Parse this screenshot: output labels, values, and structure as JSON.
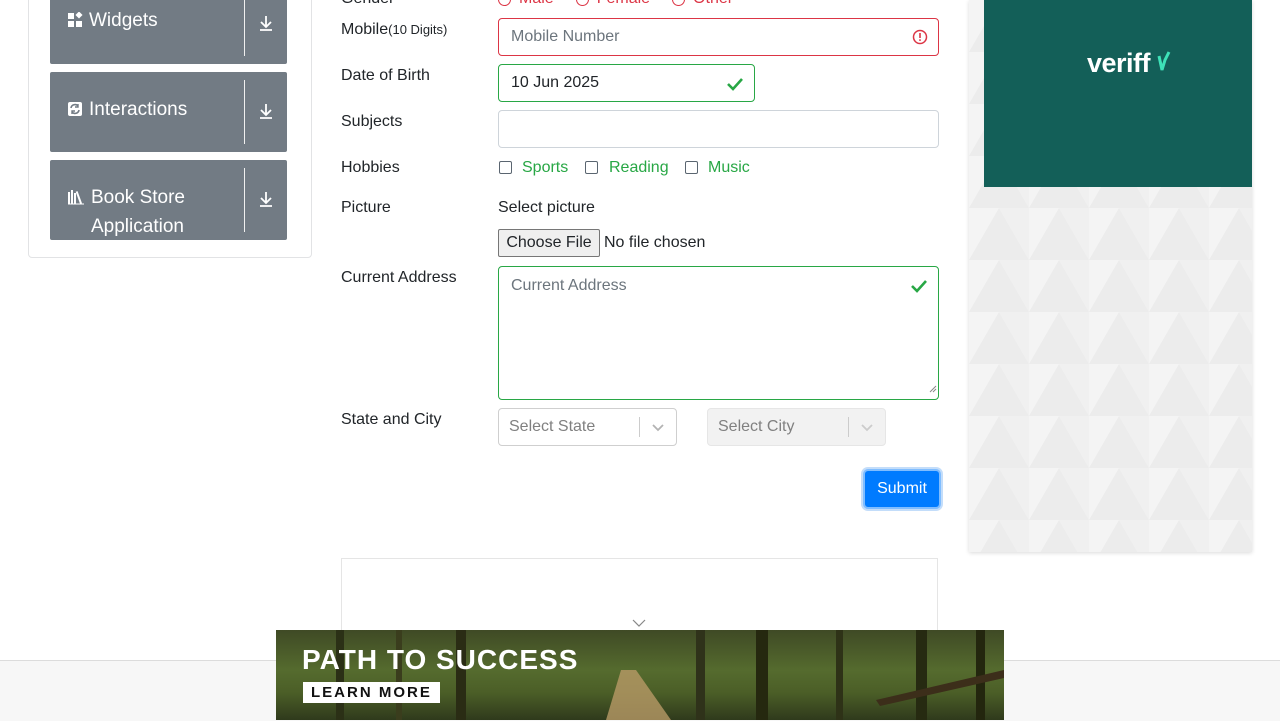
{
  "sidebar": {
    "items": [
      {
        "label": "Widgets",
        "icon": "widgets-icon"
      },
      {
        "label": "Interactions",
        "icon": "interactions-icon"
      },
      {
        "label": "Book Store Application",
        "icon": "book-icon"
      }
    ]
  },
  "form": {
    "gender": {
      "label": "Gender",
      "options": [
        "Male",
        "Female",
        "Other"
      ]
    },
    "mobile": {
      "label": "Mobile",
      "hint": "(10 Digits)",
      "placeholder": "Mobile Number"
    },
    "dob": {
      "label": "Date of Birth",
      "value": "10 Jun 2025"
    },
    "subjects": {
      "label": "Subjects",
      "value": ""
    },
    "hobbies": {
      "label": "Hobbies",
      "options": [
        "Sports",
        "Reading",
        "Music"
      ]
    },
    "picture": {
      "label": "Picture",
      "select_label": "Select picture",
      "button": "Choose File",
      "status": "No file chosen"
    },
    "address": {
      "label": "Current Address",
      "placeholder": "Current Address"
    },
    "state_city": {
      "label": "State and City",
      "state_placeholder": "Select State",
      "city_placeholder": "Select City"
    },
    "submit": "Submit"
  },
  "ads": {
    "right_brand": "veriff",
    "banner_headline": "PATH TO SUCCESS",
    "banner_cta": "LEARN MORE"
  },
  "colors": {
    "valid": "#28a745",
    "invalid": "#dc3545",
    "primary": "#007bff",
    "sidebar_bg": "#727b84",
    "veriff_teal": "#135f58"
  }
}
